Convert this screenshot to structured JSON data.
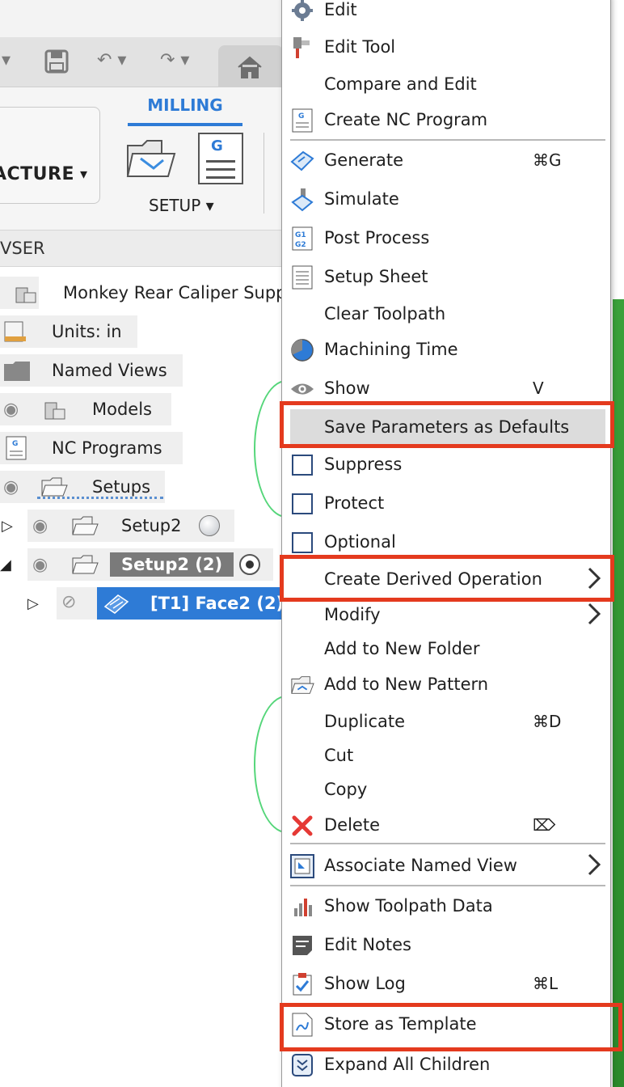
{
  "toolbar": {
    "manufacture_label": "ACTURE",
    "milling_tab": "MILLING",
    "setup_label": "SETUP"
  },
  "browser": {
    "header": "VSER",
    "items": [
      {
        "label": "Monkey Rear Caliper Supp"
      },
      {
        "label": "Units: in"
      },
      {
        "label": "Named Views"
      },
      {
        "label": "Models"
      },
      {
        "label": "NC Programs"
      },
      {
        "label": "Setups"
      },
      {
        "label": "Setup2"
      },
      {
        "label": "Setup2 (2)"
      },
      {
        "label": "[T1] Face2 (2)"
      }
    ]
  },
  "menu": {
    "items": [
      {
        "label": "Edit",
        "icon": "gear-icon"
      },
      {
        "label": "Edit Tool",
        "icon": "tool-icon"
      },
      {
        "label": "Compare and Edit"
      },
      {
        "label": "Create NC Program",
        "icon": "nc-program-icon"
      },
      {
        "label": "Generate",
        "shortcut": "⌘G",
        "icon": "generate-icon"
      },
      {
        "label": "Simulate",
        "icon": "simulate-icon"
      },
      {
        "label": "Post Process",
        "icon": "post-process-icon"
      },
      {
        "label": "Setup Sheet",
        "icon": "setup-sheet-icon"
      },
      {
        "label": "Clear Toolpath"
      },
      {
        "label": "Machining Time",
        "icon": "pie-clock-icon"
      },
      {
        "label": "Show",
        "shortcut": "V",
        "icon": "eye-icon"
      },
      {
        "label": "Save Parameters as Defaults"
      },
      {
        "label": "Suppress",
        "icon": "checkbox-icon"
      },
      {
        "label": "Protect",
        "icon": "checkbox-icon"
      },
      {
        "label": "Optional",
        "icon": "checkbox-icon"
      },
      {
        "label": "Create Derived Operation",
        "submenu": true
      },
      {
        "label": "Modify",
        "submenu": true
      },
      {
        "label": "Add to New Folder"
      },
      {
        "label": "Add to New Pattern",
        "icon": "folder-pattern-icon"
      },
      {
        "label": "Duplicate",
        "shortcut": "⌘D"
      },
      {
        "label": "Cut"
      },
      {
        "label": "Copy"
      },
      {
        "label": "Delete",
        "shortcut": "⌦",
        "icon": "red-x-icon"
      },
      {
        "label": "Associate Named View",
        "submenu": true,
        "icon": "named-view-icon"
      },
      {
        "label": "Show Toolpath Data",
        "icon": "toolpath-data-icon"
      },
      {
        "label": "Edit Notes",
        "icon": "notes-icon"
      },
      {
        "label": "Show Log",
        "shortcut": "⌘L",
        "icon": "log-icon"
      },
      {
        "label": "Store as Template",
        "icon": "template-icon"
      },
      {
        "label": "Expand All Children",
        "icon": "expand-icon"
      }
    ]
  },
  "colors": {
    "accent": "#2e7bd6",
    "highlight_box": "#e43a1e",
    "delete_x": "#e53935"
  }
}
